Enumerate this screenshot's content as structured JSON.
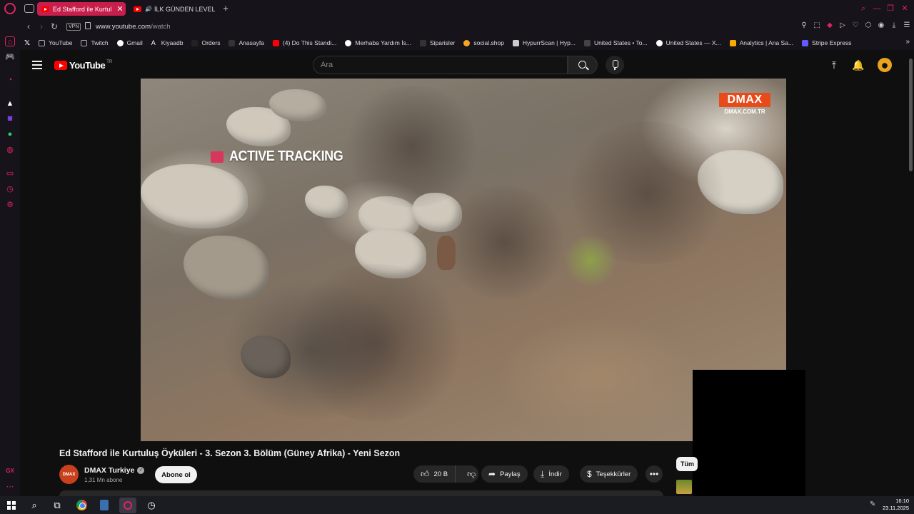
{
  "browser": {
    "tabs": [
      {
        "title": "Ed Stafford ile Kurtul",
        "active": true
      },
      {
        "title": "İLK GÜNDEN LEVEL B",
        "active": false
      }
    ],
    "vpn_label": "VPN",
    "url_host": "www.youtube.com",
    "url_path": "/watch",
    "bookmarks": [
      "YouTube",
      "Twitch",
      "Gmail",
      "Kiyaadb",
      "Orders",
      "Anasayfa",
      "(4) Do This Standi...",
      "Merhaba Yardım İs...",
      "Siparisler",
      "social.shop",
      "HypurrScan | Hyp...",
      "United States • To...",
      "United States — X...",
      "Analytics | Ana Sa...",
      "Stripe Express"
    ],
    "accent_color": "#e0245e"
  },
  "youtube": {
    "logo_text": "YouTube",
    "country_code": "TR",
    "search_placeholder": "Ara",
    "video": {
      "title": "Ed Stafford ile Kurtuluş Öyküleri - 3. Sezon 3. Bölüm (Güney Afrika) - Yeni Sezon",
      "overlay_text": "ACTIVE TRACKING",
      "watermark_brand": "DMAX",
      "watermark_site": "DMAX.COM.TR"
    },
    "channel": {
      "name": "DMAX Turkiye",
      "avatar_text": "DMAX",
      "subscribers": "1,31 Mn abone",
      "subscribe_label": "Abone ol"
    },
    "actions": {
      "likes": "20 B",
      "share": "Paylaş",
      "download": "İndir",
      "thanks": "Teşekkürler"
    },
    "recommend_chip": "Tüm"
  },
  "taskbar": {
    "time": "16:10",
    "date": "23.11.2025"
  }
}
